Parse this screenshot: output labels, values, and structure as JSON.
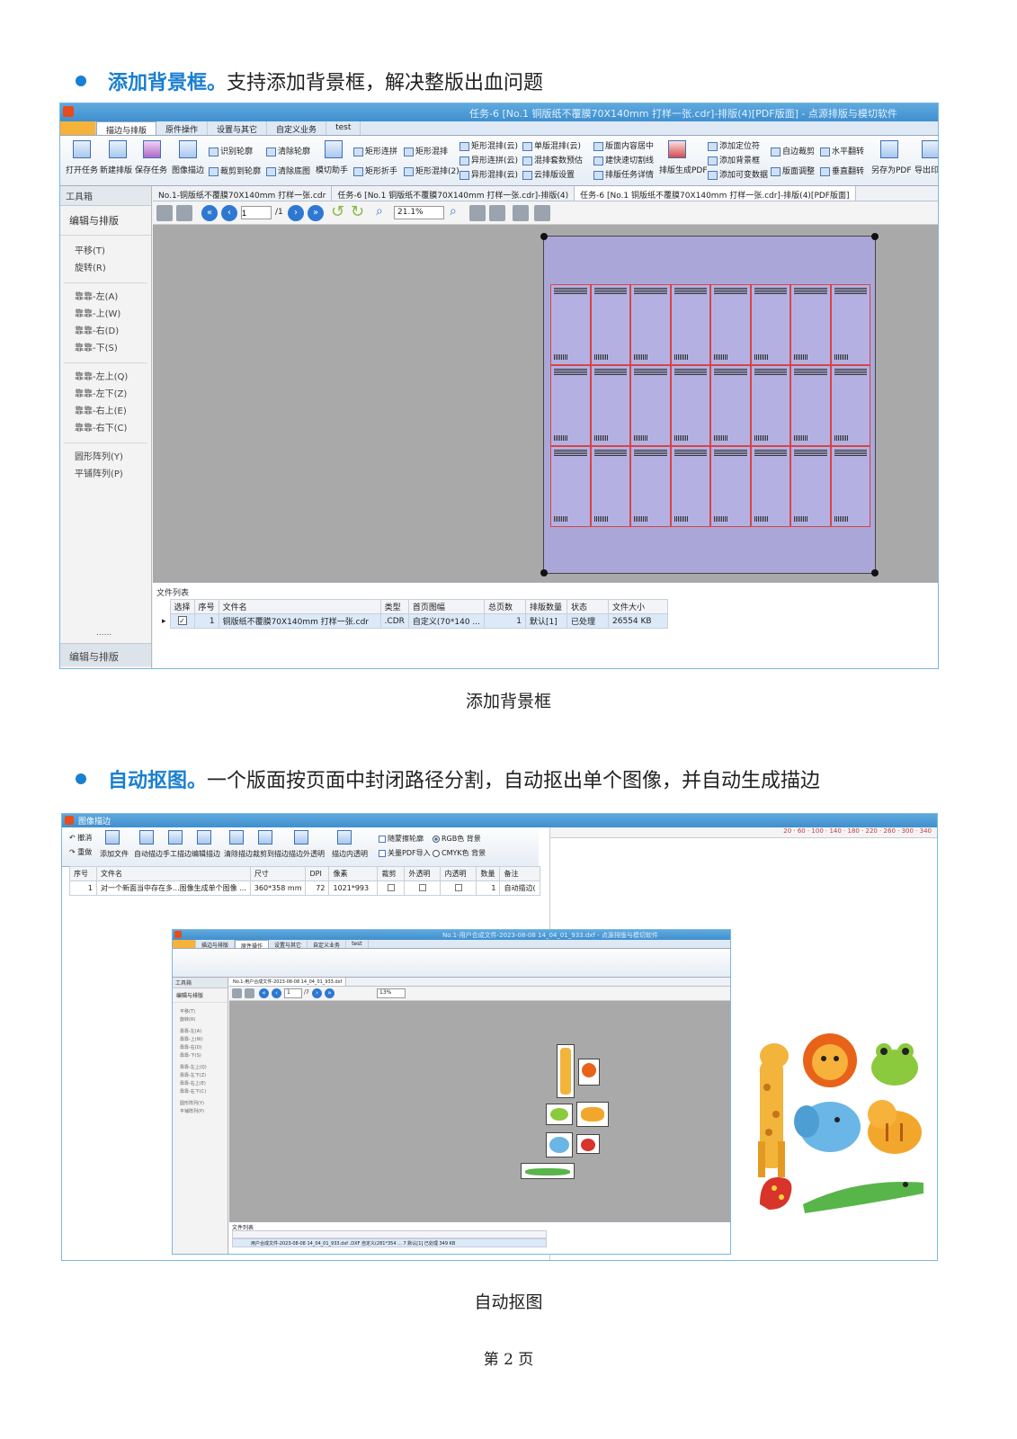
{
  "section1": {
    "heading_highlight": "添加背景框。",
    "heading_text": "支持添加背景框，解决整版出血问题",
    "caption": "添加背景框",
    "window": {
      "title": "任务-6 [No.1 铜版纸不覆膜70X140mm 打样一张.cdr]-排版(4)[PDF版面] - 点源排版与模切软件",
      "tabs": [
        "描边与排版",
        "原件操作",
        "设置与其它",
        "自定义业务",
        "test"
      ],
      "ribbon_big": [
        "打开任务",
        "新建排版",
        "保存任务",
        "图像描边"
      ],
      "ribbon_small": [
        "识别轮廓",
        "裁剪到轮廓",
        "清除轮廓",
        "清除底图",
        "模切助手",
        "矩形连拼",
        "矩形折手",
        "矩形混排",
        "矩形混排(2)",
        "矩形混排(云)",
        "异形连拼(云)",
        "异形混排(云)",
        "单版混排(云)",
        "混排套数预估",
        "云排版设置",
        "版面内容居中",
        "建快速切割线",
        "排版任务详情",
        "排版生成PDF",
        "添加定位符",
        "添加背景框",
        "添加可变数据",
        "自边裁剪",
        "版面调整",
        "水平翻转",
        "垂直翻转",
        "另存为PDF",
        "导出印"
      ],
      "sidebar": {
        "header": "工具箱",
        "group": "编辑与排版",
        "items1": [
          "平移(T)",
          "旋转(R)"
        ],
        "items2": [
          "靠靠-左(A)",
          "靠靠-上(W)",
          "靠靠-右(D)",
          "靠靠-下(S)"
        ],
        "items3": [
          "靠靠-左上(Q)",
          "靠靠-左下(Z)",
          "靠靠-右上(E)",
          "靠靠-右下(C)"
        ],
        "items4": [
          "圆形阵列(Y)",
          "平铺阵列(P)"
        ],
        "ellipsis": "......",
        "footer": "编辑与排版"
      },
      "doc_tabs": [
        "No.1-铜版纸不覆膜70X140mm 打样一张.cdr",
        "任务-6 [No.1 铜版纸不覆膜70X140mm 打样一张.cdr]-排版(4)",
        "任务-6 [No.1 铜版纸不覆膜70X140mm 打样一张.cdr]-排版(4)[PDF版面]"
      ],
      "page_input": "1",
      "page_total": "/1",
      "zoom": "21.1%",
      "file_list": {
        "title": "文件列表",
        "headers": [
          "选择",
          "序号",
          "文件名",
          "类型",
          "首页图幅",
          "总页数",
          "排版数量",
          "状态",
          "文件大小"
        ],
        "row": [
          "",
          "1",
          "铜版纸不覆膜70X140mm 打样一张.cdr",
          ".CDR",
          "自定义(70*140 ...",
          "1",
          "默认[1]",
          "已处理",
          "26554 KB"
        ]
      },
      "card_rows": 3,
      "card_cols": 8
    }
  },
  "section2": {
    "heading_highlight": "自动抠图。",
    "heading_text": "一个版面按页面中封闭路径分割，自动抠出单个图像，并自动生成描边",
    "caption": "自动抠图",
    "window": {
      "title": "图像描边",
      "toolbar_left": [
        "撤消",
        "重做"
      ],
      "toolbar": [
        "添加文件",
        "自动描边",
        "手工描边",
        "编辑描边",
        "清除描边",
        "裁剪到描边",
        "描边外透明",
        "描边内透明"
      ],
      "options": [
        "随蒙擦轮廓",
        "关量PDF导入",
        "RGB色 背景",
        "CMYK色 背景"
      ],
      "table_headers": [
        "序号",
        "文件名",
        "尺寸",
        "DPI",
        "像素",
        "裁剪",
        "外透明",
        "内透明",
        "数量",
        "备注"
      ],
      "table_row": [
        "1",
        "对一个新面当中存在多...图像生成单个图像 ...",
        "360*358 mm",
        "72",
        "1021*993",
        "",
        "",
        "",
        "1",
        "自动描边("
      ],
      "ruler": "20 · 60 · 100 · 140 · 180 · 220 · 260 · 300 · 340"
    },
    "inner_window": {
      "title": "No.1-用户合成文件-2023-08-08 14_04_01_933.dxf - 点源排版与模切软件",
      "doc_tab": "No.1-用户合成文件-2023-08-08 14_04_01_933.dxf",
      "page_input": "1",
      "page_total": "/7",
      "zoom": "13%",
      "file_row": "用户合成文件-2023-08-08 14_04_01_933.dxf   .DXF   自定义(281*354 ...   7  默认[1]  已处理   349 KB"
    }
  },
  "footer": "第 2 页"
}
